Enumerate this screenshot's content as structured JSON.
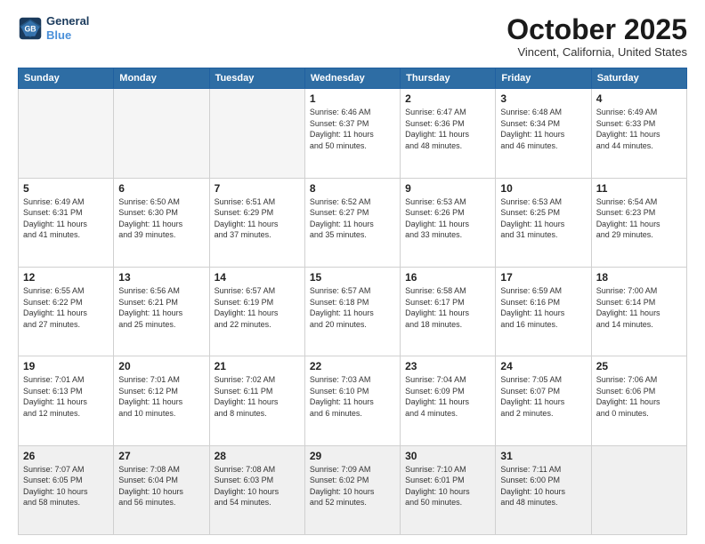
{
  "header": {
    "logo_line1": "General",
    "logo_line2": "Blue",
    "month": "October 2025",
    "location": "Vincent, California, United States"
  },
  "weekdays": [
    "Sunday",
    "Monday",
    "Tuesday",
    "Wednesday",
    "Thursday",
    "Friday",
    "Saturday"
  ],
  "weeks": [
    [
      {
        "day": "",
        "info": ""
      },
      {
        "day": "",
        "info": ""
      },
      {
        "day": "",
        "info": ""
      },
      {
        "day": "1",
        "info": "Sunrise: 6:46 AM\nSunset: 6:37 PM\nDaylight: 11 hours\nand 50 minutes."
      },
      {
        "day": "2",
        "info": "Sunrise: 6:47 AM\nSunset: 6:36 PM\nDaylight: 11 hours\nand 48 minutes."
      },
      {
        "day": "3",
        "info": "Sunrise: 6:48 AM\nSunset: 6:34 PM\nDaylight: 11 hours\nand 46 minutes."
      },
      {
        "day": "4",
        "info": "Sunrise: 6:49 AM\nSunset: 6:33 PM\nDaylight: 11 hours\nand 44 minutes."
      }
    ],
    [
      {
        "day": "5",
        "info": "Sunrise: 6:49 AM\nSunset: 6:31 PM\nDaylight: 11 hours\nand 41 minutes."
      },
      {
        "day": "6",
        "info": "Sunrise: 6:50 AM\nSunset: 6:30 PM\nDaylight: 11 hours\nand 39 minutes."
      },
      {
        "day": "7",
        "info": "Sunrise: 6:51 AM\nSunset: 6:29 PM\nDaylight: 11 hours\nand 37 minutes."
      },
      {
        "day": "8",
        "info": "Sunrise: 6:52 AM\nSunset: 6:27 PM\nDaylight: 11 hours\nand 35 minutes."
      },
      {
        "day": "9",
        "info": "Sunrise: 6:53 AM\nSunset: 6:26 PM\nDaylight: 11 hours\nand 33 minutes."
      },
      {
        "day": "10",
        "info": "Sunrise: 6:53 AM\nSunset: 6:25 PM\nDaylight: 11 hours\nand 31 minutes."
      },
      {
        "day": "11",
        "info": "Sunrise: 6:54 AM\nSunset: 6:23 PM\nDaylight: 11 hours\nand 29 minutes."
      }
    ],
    [
      {
        "day": "12",
        "info": "Sunrise: 6:55 AM\nSunset: 6:22 PM\nDaylight: 11 hours\nand 27 minutes."
      },
      {
        "day": "13",
        "info": "Sunrise: 6:56 AM\nSunset: 6:21 PM\nDaylight: 11 hours\nand 25 minutes."
      },
      {
        "day": "14",
        "info": "Sunrise: 6:57 AM\nSunset: 6:19 PM\nDaylight: 11 hours\nand 22 minutes."
      },
      {
        "day": "15",
        "info": "Sunrise: 6:57 AM\nSunset: 6:18 PM\nDaylight: 11 hours\nand 20 minutes."
      },
      {
        "day": "16",
        "info": "Sunrise: 6:58 AM\nSunset: 6:17 PM\nDaylight: 11 hours\nand 18 minutes."
      },
      {
        "day": "17",
        "info": "Sunrise: 6:59 AM\nSunset: 6:16 PM\nDaylight: 11 hours\nand 16 minutes."
      },
      {
        "day": "18",
        "info": "Sunrise: 7:00 AM\nSunset: 6:14 PM\nDaylight: 11 hours\nand 14 minutes."
      }
    ],
    [
      {
        "day": "19",
        "info": "Sunrise: 7:01 AM\nSunset: 6:13 PM\nDaylight: 11 hours\nand 12 minutes."
      },
      {
        "day": "20",
        "info": "Sunrise: 7:01 AM\nSunset: 6:12 PM\nDaylight: 11 hours\nand 10 minutes."
      },
      {
        "day": "21",
        "info": "Sunrise: 7:02 AM\nSunset: 6:11 PM\nDaylight: 11 hours\nand 8 minutes."
      },
      {
        "day": "22",
        "info": "Sunrise: 7:03 AM\nSunset: 6:10 PM\nDaylight: 11 hours\nand 6 minutes."
      },
      {
        "day": "23",
        "info": "Sunrise: 7:04 AM\nSunset: 6:09 PM\nDaylight: 11 hours\nand 4 minutes."
      },
      {
        "day": "24",
        "info": "Sunrise: 7:05 AM\nSunset: 6:07 PM\nDaylight: 11 hours\nand 2 minutes."
      },
      {
        "day": "25",
        "info": "Sunrise: 7:06 AM\nSunset: 6:06 PM\nDaylight: 11 hours\nand 0 minutes."
      }
    ],
    [
      {
        "day": "26",
        "info": "Sunrise: 7:07 AM\nSunset: 6:05 PM\nDaylight: 10 hours\nand 58 minutes."
      },
      {
        "day": "27",
        "info": "Sunrise: 7:08 AM\nSunset: 6:04 PM\nDaylight: 10 hours\nand 56 minutes."
      },
      {
        "day": "28",
        "info": "Sunrise: 7:08 AM\nSunset: 6:03 PM\nDaylight: 10 hours\nand 54 minutes."
      },
      {
        "day": "29",
        "info": "Sunrise: 7:09 AM\nSunset: 6:02 PM\nDaylight: 10 hours\nand 52 minutes."
      },
      {
        "day": "30",
        "info": "Sunrise: 7:10 AM\nSunset: 6:01 PM\nDaylight: 10 hours\nand 50 minutes."
      },
      {
        "day": "31",
        "info": "Sunrise: 7:11 AM\nSunset: 6:00 PM\nDaylight: 10 hours\nand 48 minutes."
      },
      {
        "day": "",
        "info": ""
      }
    ]
  ]
}
